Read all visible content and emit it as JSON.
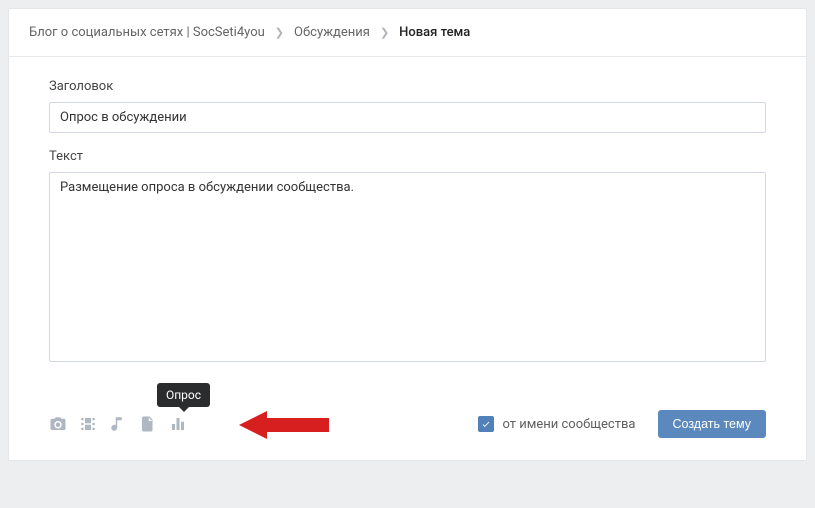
{
  "breadcrumb": {
    "group": "Блог о социальных сетях | SocSeti4you",
    "section": "Обсуждения",
    "current": "Новая тема"
  },
  "labels": {
    "title": "Заголовок",
    "text": "Текст"
  },
  "values": {
    "title": "Опрос в обсуждении",
    "body": "Размещение опроса в обсуждении сообщества."
  },
  "attach": {
    "tooltip_poll": "Опрос"
  },
  "footer": {
    "as_community": "от имени сообщества",
    "submit": "Создать тему"
  }
}
